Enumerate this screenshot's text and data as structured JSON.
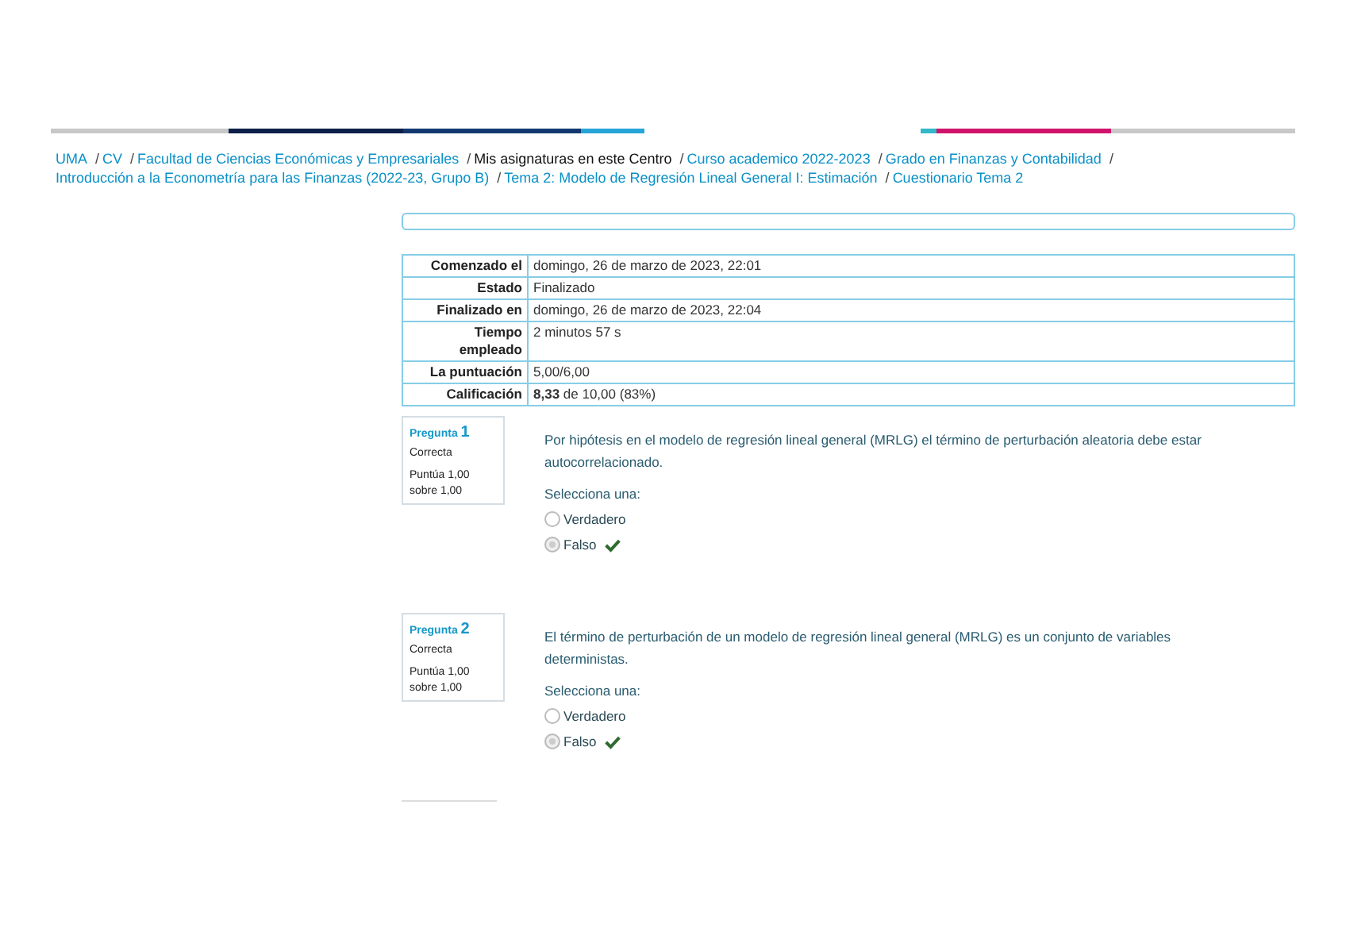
{
  "breadcrumbs": [
    {
      "label": "UMA",
      "current": false
    },
    {
      "separator": "/",
      "label": "CV",
      "current": false
    },
    {
      "separator": "/",
      "label": "Facultad de Ciencias Económicas y Empresariales",
      "current": false
    },
    {
      "separator": "/",
      "label": "Mis asignaturas en este Centro",
      "current": true
    },
    {
      "separator": "/",
      "label": "Curso academico 2022-2023",
      "current": false
    },
    {
      "separator": "/",
      "label": "Grado en Finanzas y Contabilidad",
      "current": false
    },
    {
      "separator": "/",
      "label": "Introducción a la Econometría para las Finanzas (2022-23, Grupo B)",
      "current": false
    },
    {
      "separator": "/",
      "label": "Tema 2: Modelo de Regresión Lineal General I: Estimación",
      "current": false
    },
    {
      "separator": "/",
      "label": "Cuestionario Tema 2",
      "current": false
    }
  ],
  "summary": [
    {
      "label": "Comenzado el",
      "value": "domingo, 26 de marzo de 2023, 22:01"
    },
    {
      "label": "Estado",
      "value": "Finalizado"
    },
    {
      "label": "Finalizado en",
      "value": "domingo, 26 de marzo de 2023, 22:04"
    },
    {
      "label": "Tiempo empleado",
      "value": "2 minutos 57 s"
    },
    {
      "label": "La puntuación",
      "value": "5,00/6,00"
    },
    {
      "label": "Calificación",
      "value": "**8,33** de 10,00 (83%)"
    }
  ],
  "questions": [
    {
      "label": "Pregunta",
      "number": "1",
      "status": "Correcta",
      "score": "Puntúa 1,00 sobre 1,00",
      "text": "Por hipótesis en el modelo de regresión lineal general (MRLG) el término de perturbación aleatoria debe estar autocorrelacionado.",
      "prompt": "Selecciona una:",
      "options": [
        {
          "label": "Verdadero",
          "selected": false,
          "correct": false
        },
        {
          "label": "Falso",
          "selected": true,
          "correct": true
        }
      ]
    },
    {
      "label": "Pregunta",
      "number": "2",
      "status": "Correcta",
      "score": "Puntúa 1,00 sobre 1,00",
      "text": "El término de perturbación de un modelo de regresión lineal general (MRLG) es un conjunto de variables deterministas.",
      "prompt": "Selecciona una:",
      "options": [
        {
          "label": "Verdadero",
          "selected": false,
          "correct": false
        },
        {
          "label": "Falso",
          "selected": true,
          "correct": true
        }
      ]
    }
  ]
}
